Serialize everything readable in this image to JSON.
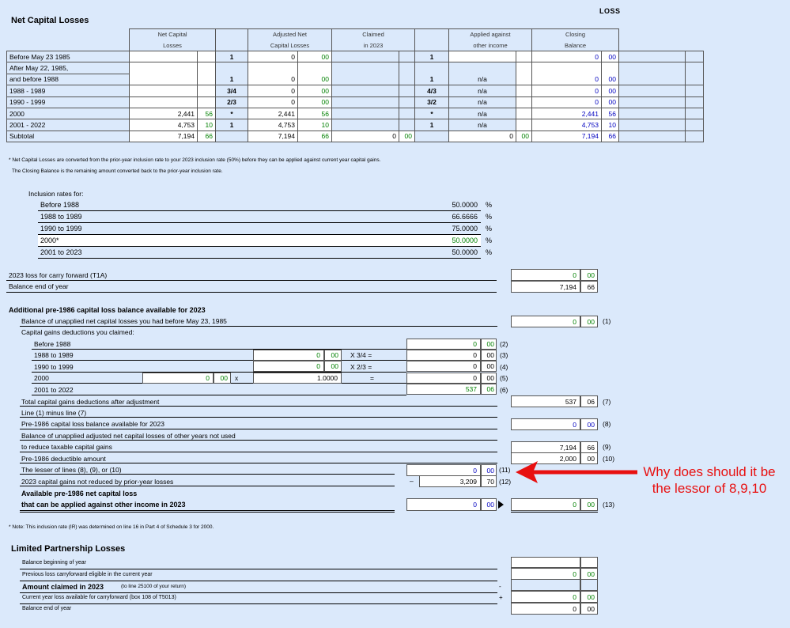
{
  "header": {
    "loss_tag": "LOSS",
    "title": "Net Capital Losses"
  },
  "table": {
    "columns": [
      [
        "Net Capital",
        "Losses"
      ],
      [
        "Adjusted Net",
        "Capital Losses"
      ],
      [
        "Claimed",
        "in 2023"
      ],
      [
        "Applied against",
        "other income"
      ],
      [
        "Closing",
        "Balance"
      ]
    ],
    "rows": [
      {
        "label": "Before May 23 1985",
        "ncl": "",
        "ncl_c": "",
        "f1": "1",
        "adj": "0",
        "adj_c": "00",
        "cl": "",
        "cl_c": "",
        "f2": "1",
        "app": "",
        "close": "0",
        "close_c": "00"
      },
      {
        "label": "After May 22, 1985,",
        "ncl": "",
        "ncl_c": "",
        "f1": "",
        "adj": "",
        "adj_c": "",
        "cl": "",
        "cl_c": "",
        "f2": "",
        "app": "",
        "close": "",
        "close_c": ""
      },
      {
        "label": "and before 1988",
        "ncl": "",
        "ncl_c": "",
        "f1": "1",
        "adj": "0",
        "adj_c": "00",
        "cl": "",
        "cl_c": "",
        "f2": "1",
        "app": "n/a",
        "close": "0",
        "close_c": "00"
      },
      {
        "label": "1988 - 1989",
        "ncl": "",
        "ncl_c": "",
        "f1": "3/4",
        "adj": "0",
        "adj_c": "00",
        "cl": "",
        "cl_c": "",
        "f2": "4/3",
        "app": "n/a",
        "close": "0",
        "close_c": "00"
      },
      {
        "label": "1990 - 1999",
        "ncl": "",
        "ncl_c": "",
        "f1": "2/3",
        "adj": "0",
        "adj_c": "00",
        "cl": "",
        "cl_c": "",
        "f2": "3/2",
        "app": "n/a",
        "close": "0",
        "close_c": "00"
      },
      {
        "label": "2000",
        "ncl": "2,441",
        "ncl_c": "56",
        "f1": "*",
        "adj": "2,441",
        "adj_c": "56",
        "cl": "",
        "cl_c": "",
        "f2": "*",
        "app": "n/a",
        "close": "2,441",
        "close_c": "56"
      },
      {
        "label": "2001 - 2022",
        "ncl": "4,753",
        "ncl_c": "10",
        "f1": "1",
        "adj": "4,753",
        "adj_c": "10",
        "cl": "",
        "cl_c": "",
        "f2": "1",
        "app": "n/a",
        "close": "4,753",
        "close_c": "10"
      },
      {
        "label": "Subtotal",
        "ncl": "7,194",
        "ncl_c": "66",
        "f1": "",
        "adj": "7,194",
        "adj_c": "66",
        "cl": "0",
        "cl_c": "00",
        "f2": "",
        "app": "0",
        "app_c": "00",
        "close": "7,194",
        "close_c": "66"
      }
    ]
  },
  "notes": {
    "note1": "* Net Capital Losses are converted from the prior-year inclusion rate to your 2023 inclusion rate (50%) before they can be applied against current year capital gains.",
    "note2": "The Closing Balance is the remaining amount converted back to the prior-year inclusion rate."
  },
  "inclusion": {
    "title": "Inclusion rates for:",
    "rows": [
      {
        "label": "Before 1988",
        "value": "50.0000",
        "pct": "%"
      },
      {
        "label": "1988 to 1989",
        "value": "66.6666",
        "pct": "%"
      },
      {
        "label": "1990 to 1999",
        "value": "75.0000",
        "pct": "%"
      },
      {
        "label": "2000*",
        "value": "50.0000",
        "pct": "%"
      },
      {
        "label": "2001 to 2023",
        "value": "50.0000",
        "pct": "%"
      }
    ]
  },
  "carry": {
    "l1": "2023 loss for carry forward (T1A)",
    "v1": "0",
    "c1": "00",
    "l2": "Balance end of year",
    "v2": "7,194",
    "c2": "66"
  },
  "pre1986": {
    "title": "Additional pre-1986 capital loss balance available for 2023",
    "balance_label": "Balance of unapplied net capital losses you had before May 23, 1985",
    "balance": "0",
    "balance_c": "00",
    "line1": "(1)",
    "deductions_label": "Capital gains deductions you claimed:",
    "before1988": "Before 1988",
    "v2": "0",
    "c2": "00",
    "line2": "(2)",
    "r88": "1988 to 1989",
    "r88_a": "0",
    "r88_ac": "00",
    "r88_x": "X 3/4 =",
    "v3": "0",
    "c3": "00",
    "line3": "(3)",
    "r90": "1990 to 1999",
    "r90_a": "0",
    "r90_ac": "00",
    "r90_x": "X 2/3 =",
    "v4": "0",
    "c4": "00",
    "line4": "(4)",
    "r2000": "2000",
    "r2000_a": "0",
    "r2000_ac": "00",
    "r2000_x": "x",
    "r2000_rate": "1.0000",
    "r2000_eq": "=",
    "v5": "0",
    "c5": "00",
    "line5": "(5)",
    "r2001": "2001 to 2022",
    "v6": "537",
    "c6": "06",
    "line6": "(6)",
    "total_label": "Total capital gains deductions after adjustment",
    "v7": "537",
    "c7": "06",
    "line7": "(7)",
    "minus_label": "Line (1) minus line (7)",
    "pre_label": "Pre-1986 capital loss balance available for 2023",
    "v8": "0",
    "c8": "00",
    "line8": "(8)",
    "unapplied1": "Balance of unapplied adjusted net capital losses of other years not used",
    "unapplied2": "to reduce taxable capital gains",
    "v9": "7,194",
    "c9": "66",
    "line9": "(9)",
    "deductible_label": "Pre-1986 deductible amount",
    "v10": "2,000",
    "c10": "00",
    "line10": "(10)",
    "lesser_label": "The lesser of lines (8), (9), or (10)",
    "v11": "0",
    "c11": "00",
    "line11": "(11)",
    "gains_label": "2023 capital gains not reduced by prior-year losses",
    "gains_sign": "–",
    "v12": "3,209",
    "c12": "70",
    "line12": "(12)",
    "avail1": "Available pre-1986 net capital loss",
    "avail2": "that can be applied against other income in 2023",
    "v13a": "0",
    "c13a": "00",
    "v13": "0",
    "c13": "00",
    "line13": "(13)"
  },
  "note_ir": "* Note: This inclusion rate (IR) was determined on line 16 in Part 4 of Schedule 3 for 2000.",
  "lp": {
    "title": "Limited Partnership Losses",
    "r1": "Balance beginning of year",
    "r2": "Previous loss carryforward eligible in the current year",
    "v2": "0",
    "c2": "00",
    "r3": "Amount claimed in 2023",
    "r3_small": "(to line 25100 of your return)",
    "s3": "-",
    "r4": "Current year loss available for carryforward (box 108 of T5013)",
    "s4": "+",
    "v4": "0",
    "c4": "00",
    "r5": "Balance end of year",
    "v5": "0",
    "c5": "00"
  },
  "annotation": {
    "text": "Why does should it be the lessor of 8,9,10",
    "color": "#e81010"
  }
}
